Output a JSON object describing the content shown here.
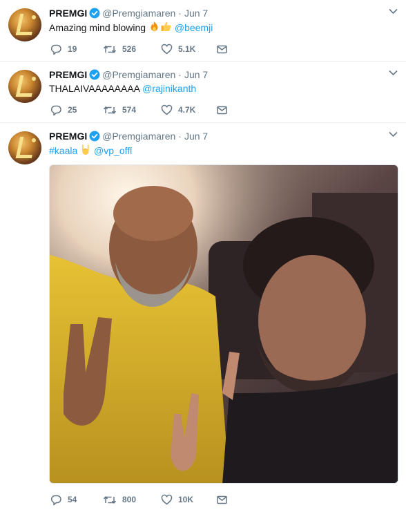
{
  "tweets": [
    {
      "name": "PREMGI",
      "handle": "@Premgiamaren",
      "separator": "·",
      "date": "Jun 7",
      "text": "Amazing mind blowing",
      "emojis": [
        "fire-emoji",
        "thumbs-up-emoji"
      ],
      "mention": "@beemji",
      "replies": "19",
      "retweets": "526",
      "likes": "5.1K"
    },
    {
      "name": "PREMGI",
      "handle": "@Premgiamaren",
      "separator": "·",
      "date": "Jun 7",
      "text": "THALAIVAAAAAAAA",
      "mention": "@rajinikanth",
      "replies": "25",
      "retweets": "574",
      "likes": "4.7K"
    },
    {
      "name": "PREMGI",
      "handle": "@Premgiamaren",
      "separator": "·",
      "date": "Jun 7",
      "hashtag": "#kaala",
      "emojis": [
        "rock-on-hand-emoji"
      ],
      "mention": "@vp_offl",
      "replies": "54",
      "retweets": "800",
      "likes": "10K"
    }
  ],
  "icons": {
    "reply": "reply-icon",
    "retweet": "retweet-icon",
    "like": "heart-icon",
    "dm": "envelope-icon",
    "more": "chevron-down-icon",
    "verified": "verified-badge-icon"
  },
  "colors": {
    "link": "#1da1f2",
    "secondary_text": "#657786",
    "divider": "#e6ecf0",
    "verified": "#1da1f2"
  }
}
